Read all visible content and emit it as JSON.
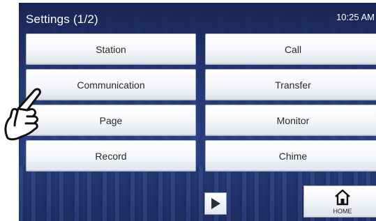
{
  "header": {
    "title": "Settings (1/2)",
    "time": "10:25 AM"
  },
  "menu": {
    "station": "Station",
    "call": "Call",
    "communication": "Communication",
    "transfer": "Transfer",
    "page": "Page",
    "monitor": "Monitor",
    "record": "Record",
    "chime": "Chime"
  },
  "footer": {
    "home_label": "HOME"
  },
  "icons": {
    "next": "play-arrow-icon",
    "home": "home-icon",
    "pointer": "hand-pointer-icon"
  }
}
